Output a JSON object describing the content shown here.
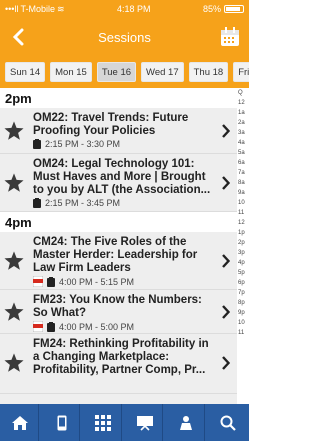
{
  "status": {
    "carrier": "T-Mobile",
    "time": "4:18 PM",
    "battery": "85%"
  },
  "nav": {
    "title": "Sessions"
  },
  "days": [
    {
      "label": "Sun 14",
      "selected": false
    },
    {
      "label": "Mon 15",
      "selected": false
    },
    {
      "label": "Tue 16",
      "selected": true
    },
    {
      "label": "Wed 17",
      "selected": false
    },
    {
      "label": "Thu 18",
      "selected": false
    },
    {
      "label": "Fri 19",
      "selected": false
    }
  ],
  "sections": [
    {
      "header": "2pm",
      "sessions": [
        {
          "title": "OM22: Travel Trends: Future Proofing Your Policies",
          "time": "2:15 PM - 3:30 PM",
          "has_pdf": false
        },
        {
          "title": "OM24: Legal Technology 101: Must Haves and More | Brought to you by ALT (the Association...",
          "time": "2:15 PM - 3:45 PM",
          "has_pdf": false
        }
      ]
    },
    {
      "header": "4pm",
      "sessions": [
        {
          "title": "CM24: The Five Roles of the Master Herder: Leadership for Law Firm Leaders",
          "time": "4:00 PM - 5:15 PM",
          "has_pdf": true
        },
        {
          "title": "FM23: You Know the Numbers: So What?",
          "time": "4:00 PM - 5:00 PM",
          "has_pdf": true
        },
        {
          "title": "FM24: Rethinking Profitability in a Changing Marketplace: Profitability, Partner Comp, Pr...",
          "time": "",
          "has_pdf": false
        }
      ]
    }
  ],
  "index": [
    "Q",
    "12",
    "1a",
    "2a",
    "3a",
    "4a",
    "5a",
    "6a",
    "7a",
    "8a",
    "9a",
    "10",
    "11",
    "12",
    "1p",
    "2p",
    "3p",
    "4p",
    "5p",
    "6p",
    "7p",
    "8p",
    "9p",
    "10",
    "11"
  ],
  "tabs": [
    "home-icon",
    "phone-icon",
    "grid-icon",
    "presentation-icon",
    "attendee-icon",
    "search-icon"
  ],
  "colors": {
    "accent": "#f6a21a",
    "tabbar": "#2a5ea3"
  }
}
